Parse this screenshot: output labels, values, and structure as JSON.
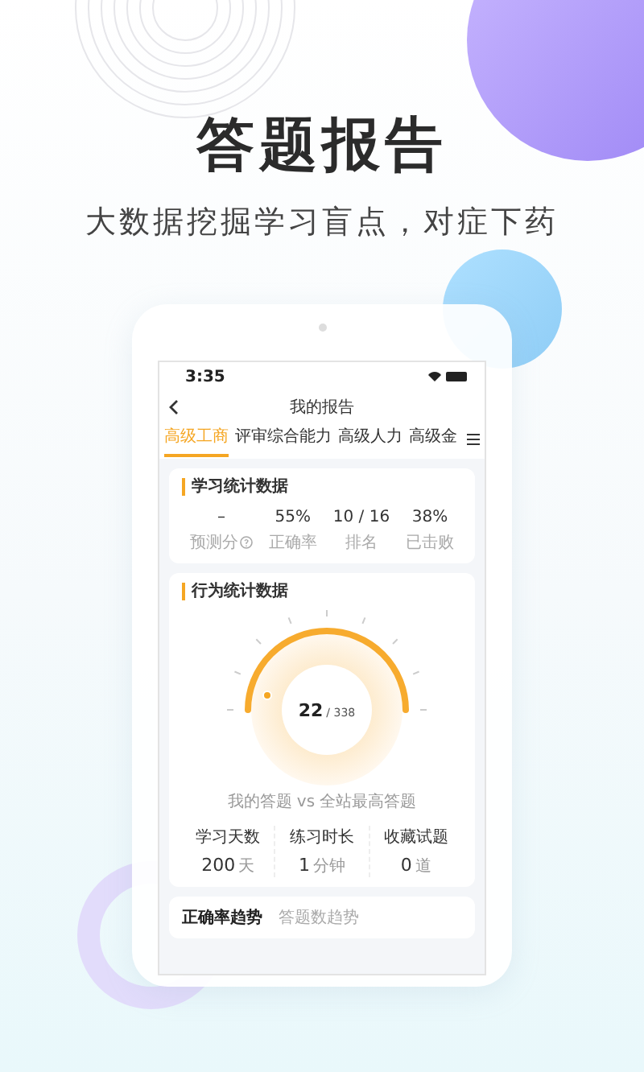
{
  "headline": "答题报告",
  "subtitle": "大数据挖掘学习盲点，对症下药",
  "phone": {
    "status_time": "3:35",
    "nav_title": "我的报告",
    "tabs": [
      {
        "label": "高级工商",
        "selected": true
      },
      {
        "label": "评审综合能力",
        "selected": false
      },
      {
        "label": "高级人力",
        "selected": false
      },
      {
        "label": "高级金",
        "selected": false
      }
    ],
    "study_stats": {
      "title": "学习统计数据",
      "items": [
        {
          "value": "–",
          "label": "预测分",
          "help": true
        },
        {
          "value": "55%",
          "label": "正确率",
          "help": false
        },
        {
          "value": "10 / 16",
          "label": "排名",
          "help": false
        },
        {
          "value": "38%",
          "label": "已击败",
          "help": false
        }
      ]
    },
    "behavior": {
      "title": "行为统计数据",
      "gauge_value": "22",
      "gauge_total": "/ 338",
      "caption": "我的答题 vs 全站最高答题",
      "metrics": [
        {
          "label": "学习天数",
          "value": "200",
          "unit": "天"
        },
        {
          "label": "练习时长",
          "value": "1",
          "unit": "分钟"
        },
        {
          "label": "收藏试题",
          "value": "0",
          "unit": "道"
        }
      ]
    },
    "trend_tabs": [
      {
        "label": "正确率趋势",
        "selected": true
      },
      {
        "label": "答题数趋势",
        "selected": false
      }
    ]
  }
}
